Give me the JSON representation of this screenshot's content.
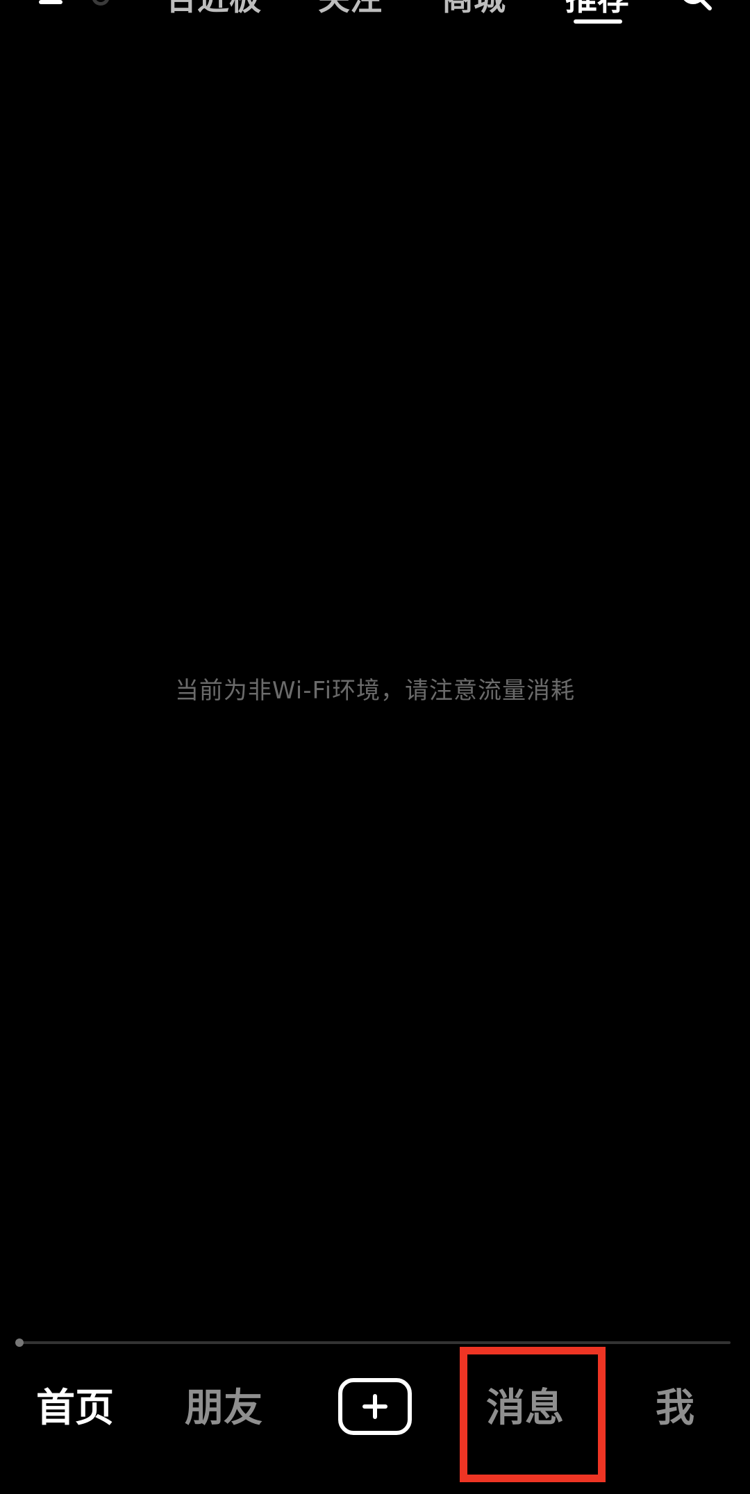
{
  "top_bar": {
    "tabs": [
      {
        "label": "合近板",
        "active": false
      },
      {
        "label": "关注",
        "active": false
      },
      {
        "label": "商城",
        "active": false
      },
      {
        "label": "推荐",
        "active": true
      }
    ],
    "icons": {
      "menu": "menu-icon",
      "live": "live-icon",
      "search": "search-icon"
    }
  },
  "content": {
    "network_hint": "当前为非Wi-Fi环境，请注意流量消耗"
  },
  "player": {
    "progress": 0.0
  },
  "bottom_nav": {
    "items": [
      {
        "label": "首页",
        "active": true
      },
      {
        "label": "朋友",
        "active": false
      },
      {
        "label": "",
        "icon": "plus-icon"
      },
      {
        "label": "消息",
        "active": false
      },
      {
        "label": "我",
        "active": false
      }
    ]
  },
  "colors": {
    "background": "#000000",
    "active_text": "#ffffff",
    "inactive_text": "#8f8f8f",
    "hint_text": "#6b6b6b",
    "highlight": "#ee3524"
  }
}
